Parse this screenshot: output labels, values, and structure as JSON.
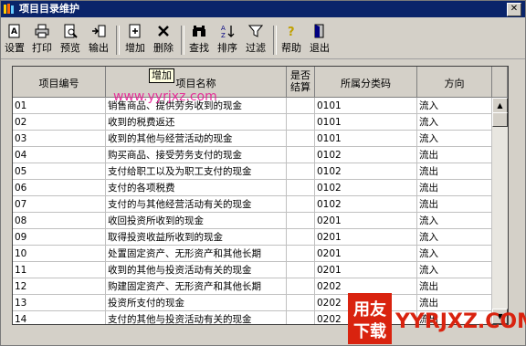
{
  "window": {
    "title": "项目目录维护",
    "close_glyph": "✕"
  },
  "toolbar": {
    "buttons": [
      {
        "label": "设置",
        "icon": "settings-icon"
      },
      {
        "label": "打印",
        "icon": "printer-icon"
      },
      {
        "label": "预览",
        "icon": "preview-icon"
      },
      {
        "label": "输出",
        "icon": "export-icon"
      },
      {
        "label": "增加",
        "icon": "add-icon"
      },
      {
        "label": "删除",
        "icon": "delete-icon"
      },
      {
        "label": "查找",
        "icon": "binoculars-icon"
      },
      {
        "label": "排序",
        "icon": "sort-icon"
      },
      {
        "label": "过滤",
        "icon": "filter-icon"
      },
      {
        "label": "帮助",
        "icon": "help-icon"
      },
      {
        "label": "退出",
        "icon": "exit-icon"
      }
    ]
  },
  "tooltip": "增加",
  "watermark": "www.yyrjxz.com",
  "logo": {
    "line1": "用友",
    "line2": "下载",
    "text": "YYRJXZ.COM"
  },
  "table": {
    "columns": [
      "项目编号",
      "项目名称",
      "是否结算",
      "所属分类码",
      "方向"
    ],
    "rows": [
      [
        "01",
        "销售商品、提供劳务收到的现金",
        "",
        "0101",
        "流入"
      ],
      [
        "02",
        "收到的税费返还",
        "",
        "0101",
        "流入"
      ],
      [
        "03",
        "收到的其他与经营活动的现金",
        "",
        "0101",
        "流入"
      ],
      [
        "04",
        "购买商品、接受劳务支付的现金",
        "",
        "0102",
        "流出"
      ],
      [
        "05",
        "支付给职工以及为职工支付的现金",
        "",
        "0102",
        "流出"
      ],
      [
        "06",
        "支付的各项税费",
        "",
        "0102",
        "流出"
      ],
      [
        "07",
        "支付的与其他经营活动有关的现金",
        "",
        "0102",
        "流出"
      ],
      [
        "08",
        "收回投资所收到的现金",
        "",
        "0201",
        "流入"
      ],
      [
        "09",
        "取得投资收益所收到的现金",
        "",
        "0201",
        "流入"
      ],
      [
        "10",
        "处置固定资产、无形资产和其他长期",
        "",
        "0201",
        "流入"
      ],
      [
        "11",
        "收到的其他与投资活动有关的现金",
        "",
        "0201",
        "流入"
      ],
      [
        "12",
        "购建固定资产、无形资产和其他长期",
        "",
        "0202",
        "流出"
      ],
      [
        "13",
        "投资所支付的现金",
        "",
        "0202",
        "流出"
      ],
      [
        "14",
        "支付的其他与投资活动有关的现金",
        "",
        "0202",
        "流出"
      ]
    ]
  }
}
